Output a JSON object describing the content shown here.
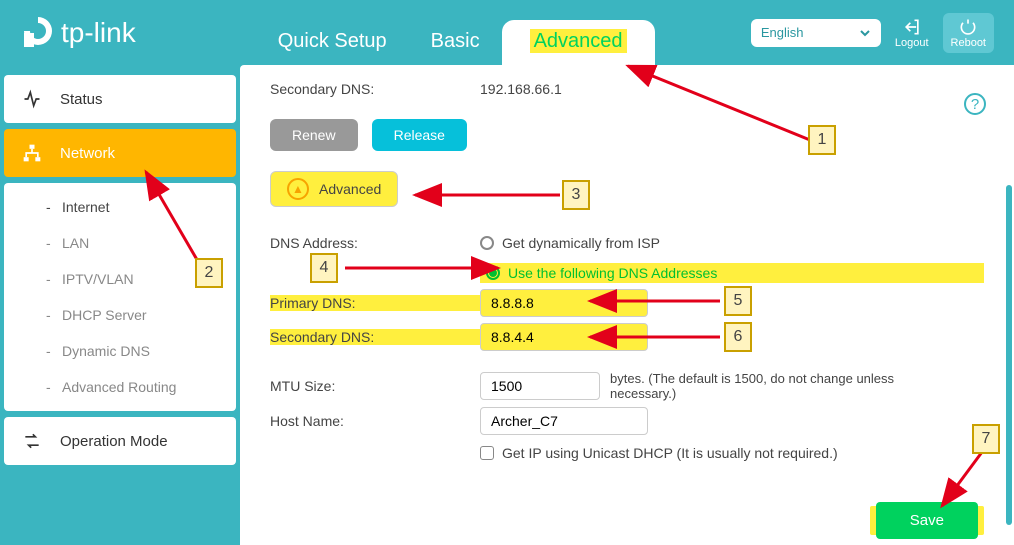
{
  "brand": "tp-link",
  "header": {
    "tabs": {
      "quick_setup": "Quick Setup",
      "basic": "Basic",
      "advanced": "Advanced"
    },
    "language": "English",
    "logout": "Logout",
    "reboot": "Reboot"
  },
  "sidebar": {
    "status": "Status",
    "network": "Network",
    "operation_mode": "Operation Mode",
    "subs": {
      "internet": "Internet",
      "lan": "LAN",
      "iptv_vlan": "IPTV/VLAN",
      "dhcp_server": "DHCP Server",
      "dynamic_dns": "Dynamic DNS",
      "advanced_routing": "Advanced Routing"
    }
  },
  "content": {
    "secondary_dns_ro_label": "Secondary DNS:",
    "secondary_dns_ro_value": "192.168.66.1",
    "renew": "Renew",
    "release": "Release",
    "adv_toggle": "Advanced",
    "dns_address_label": "DNS Address:",
    "dns_opt1": "Get dynamically from ISP",
    "dns_opt2": "Use the following DNS Addresses",
    "primary_dns_label": "Primary DNS:",
    "primary_dns_value": "8.8.8.8",
    "secondary_dns_label": "Secondary DNS:",
    "secondary_dns_value": "8.8.4.4",
    "mtu_label": "MTU Size:",
    "mtu_value": "1500",
    "mtu_note": "bytes. (The default is 1500, do not change unless necessary.)",
    "host_label": "Host Name:",
    "host_value": "Archer_C7",
    "unicast_label": "Get IP using Unicast DHCP (It is usually not required.)",
    "save": "Save"
  },
  "callouts": {
    "c1": "1",
    "c2": "2",
    "c3": "3",
    "c4": "4",
    "c5": "5",
    "c6": "6",
    "c7": "7"
  }
}
